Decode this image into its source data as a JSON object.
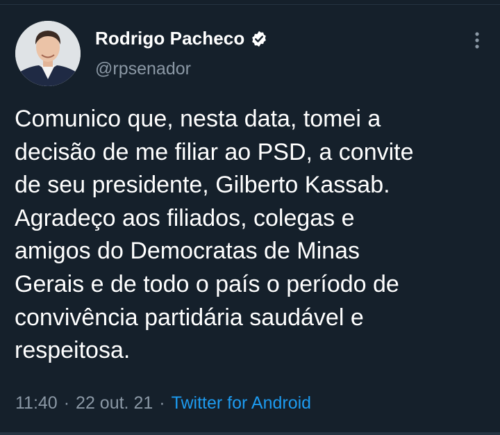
{
  "tweet": {
    "author": {
      "display_name": "Rodrigo Pacheco",
      "handle": "@rpsenador",
      "verified": true,
      "avatar_icon": "profile-photo"
    },
    "more_icon": "more-vertical-icon",
    "text": "Comunico que, nesta data, tomei a\ndecisão de me filiar ao PSD, a convite\nde seu presidente, Gilberto Kassab.\nAgradeço aos filiados, colegas e\namigos do Democratas de Minas\nGerais e de todo o país o período de\nconvivência partidária saudável e\nrespeitosa.",
    "meta": {
      "time": "11:40",
      "separator": "·",
      "date": "22 out. 21",
      "source": "Twitter for Android"
    }
  },
  "colors": {
    "background": "#15202b",
    "text": "#ffffff",
    "muted": "#8b98a5",
    "accent": "#1d9bf0"
  }
}
